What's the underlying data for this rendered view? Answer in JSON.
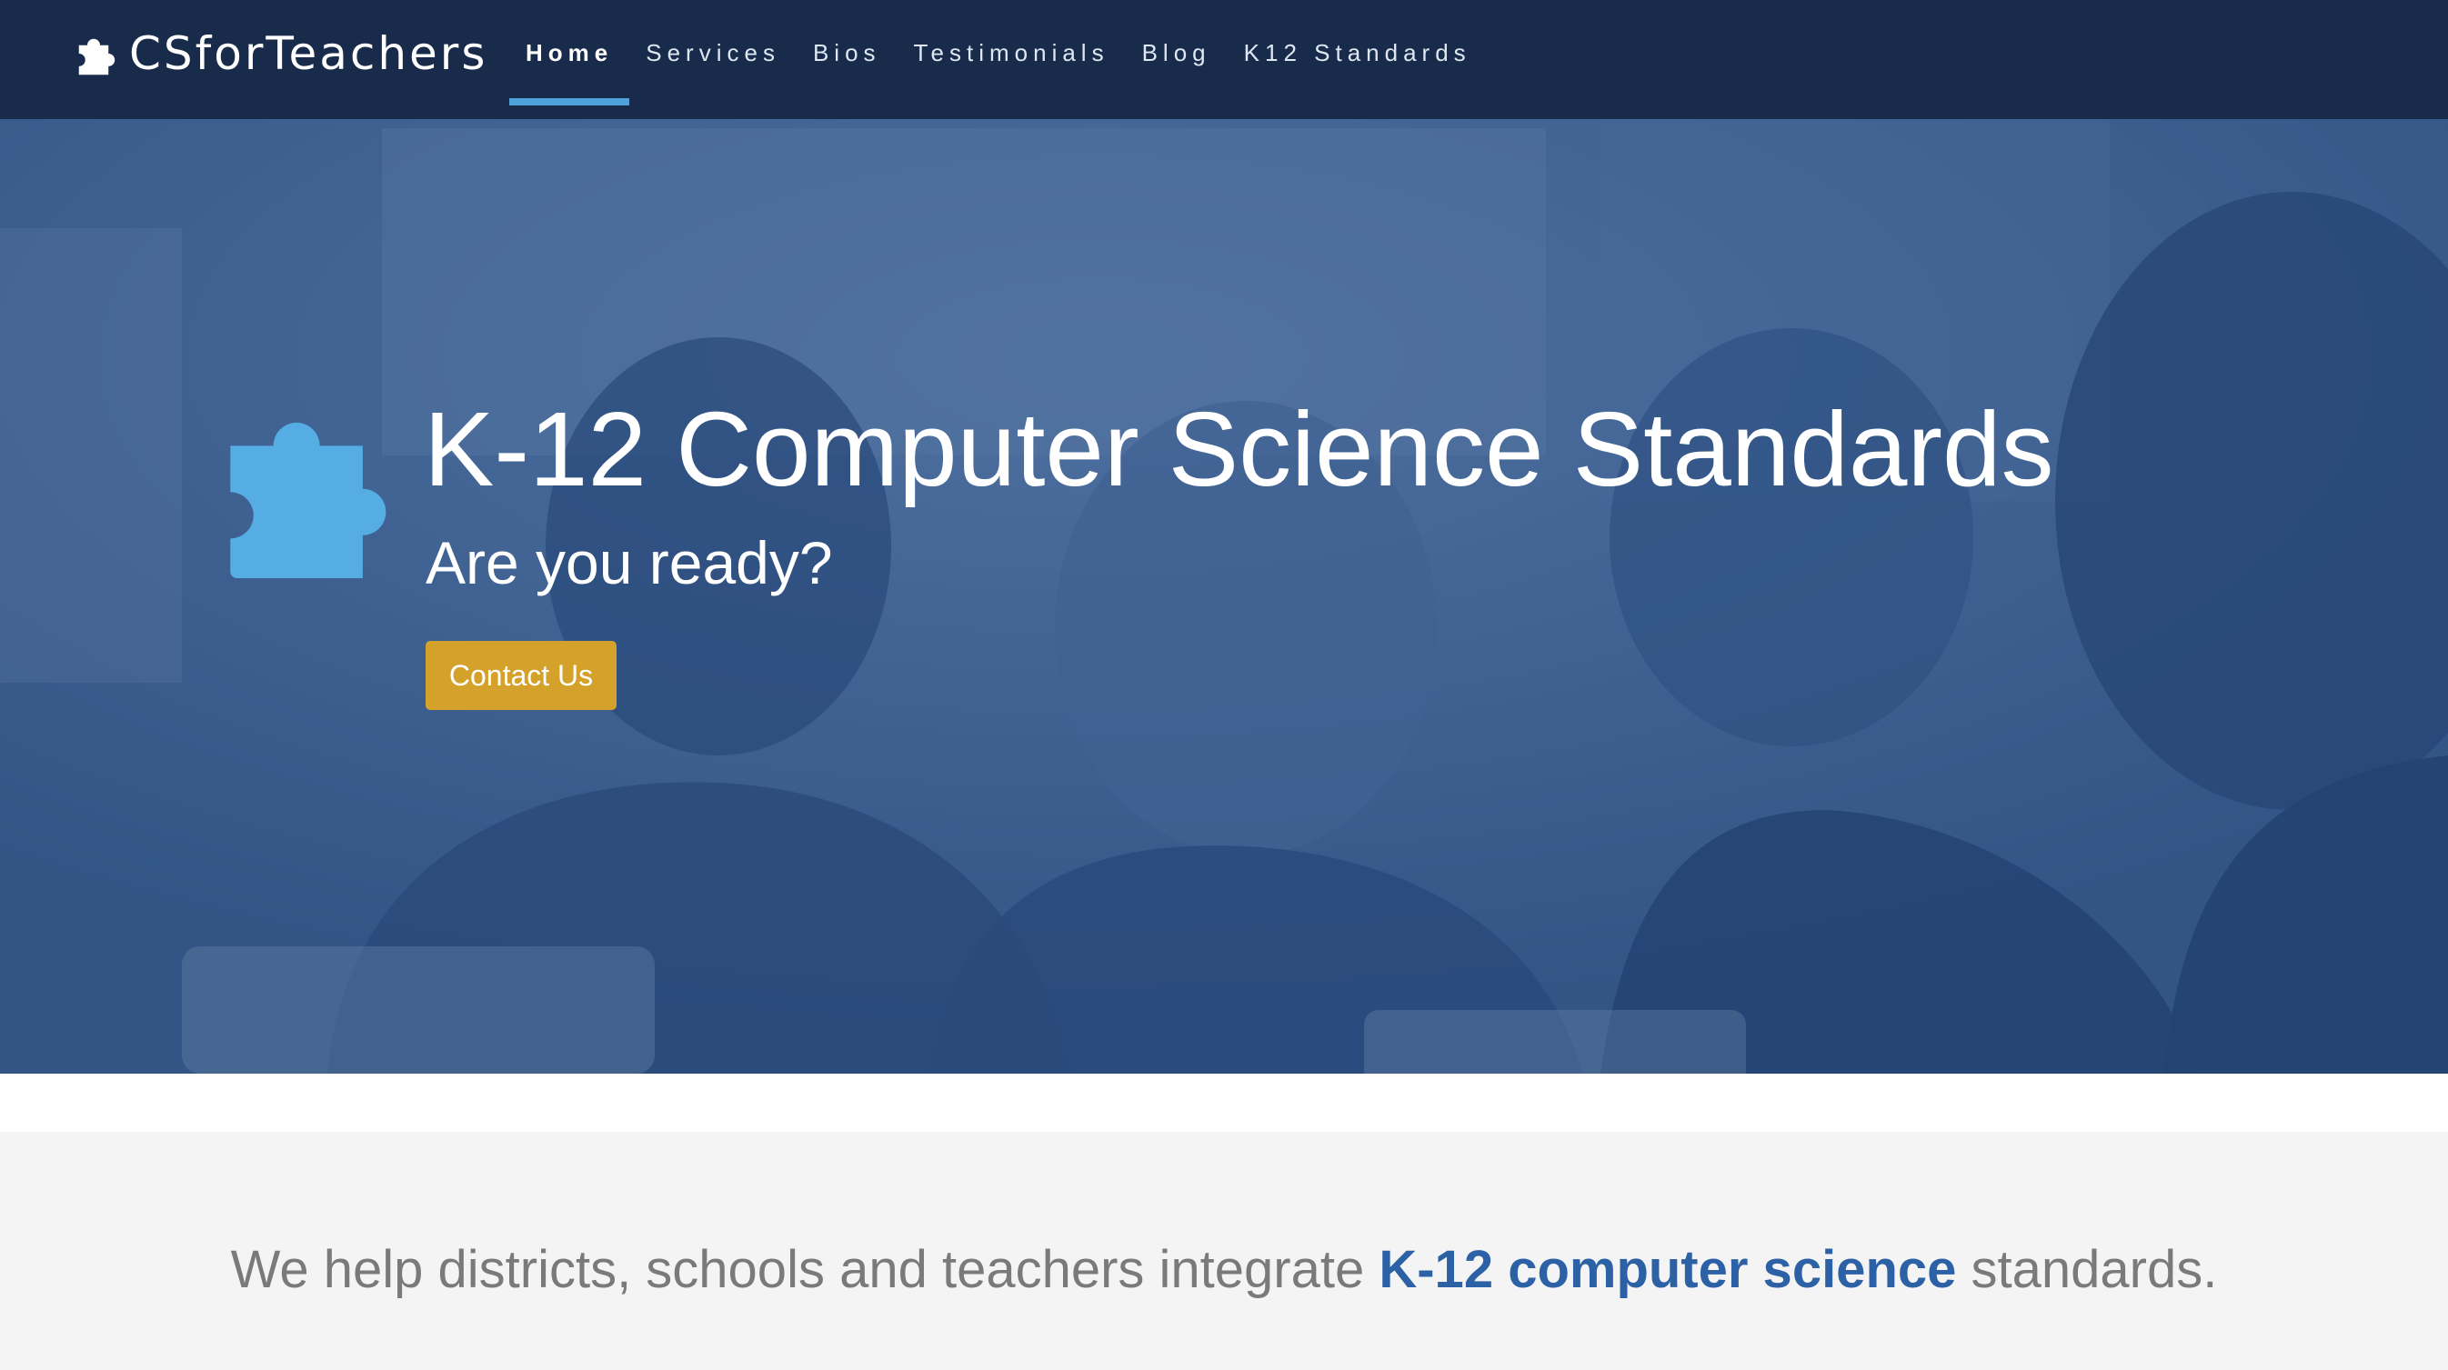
{
  "navbar": {
    "brand": "CSforTeachers",
    "items": [
      {
        "label": "Home",
        "active": true
      },
      {
        "label": "Services",
        "active": false
      },
      {
        "label": "Bios",
        "active": false
      },
      {
        "label": "Testimonials",
        "active": false
      },
      {
        "label": "Blog",
        "active": false
      },
      {
        "label": "K12 Standards",
        "active": false
      }
    ]
  },
  "hero": {
    "title": "K-12 Computer Science Standards",
    "subtitle": "Are you ready?",
    "cta_label": "Contact Us",
    "icon": "puzzle-piece-icon"
  },
  "tagline": {
    "prefix": "We help districts, schools and teachers integrate ",
    "highlight": "K-12 computer science",
    "suffix": " standards."
  },
  "colors": {
    "navbar_bg": "#182b4a",
    "nav_active_underline": "#4fa3dd",
    "hero_overlay": "#284c80",
    "puzzle_icon": "#55ade3",
    "cta_bg": "#d4a22b",
    "tagline_highlight": "#2d61a6",
    "tagline_text": "#7a7a7a",
    "tagline_bg": "#f4f4f4"
  }
}
